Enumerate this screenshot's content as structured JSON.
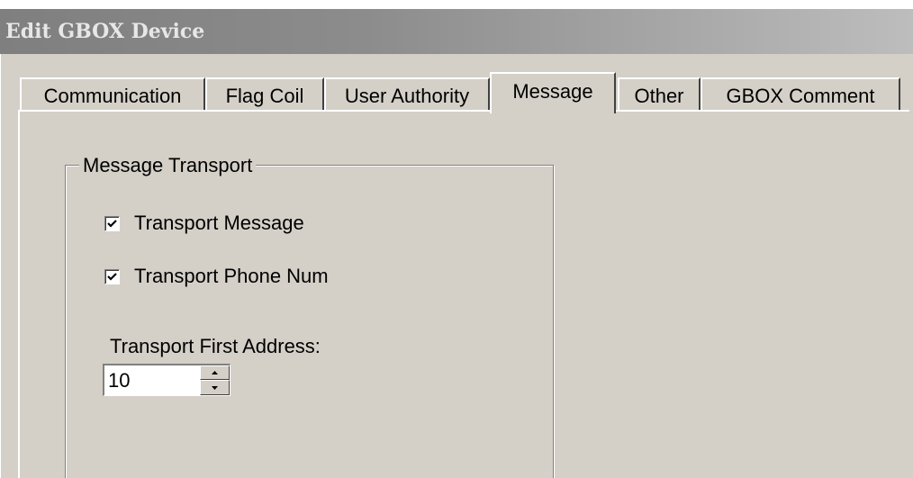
{
  "window": {
    "title": "Edit GBOX Device"
  },
  "tabs": [
    {
      "label": "Communication",
      "active": false
    },
    {
      "label": "Flag Coil",
      "active": false
    },
    {
      "label": "User Authority",
      "active": false
    },
    {
      "label": "Message",
      "active": true
    },
    {
      "label": "Other",
      "active": false
    },
    {
      "label": "GBOX Comment",
      "active": false
    }
  ],
  "message_transport": {
    "group_label": "Message Transport",
    "transport_message": {
      "label": "Transport Message",
      "checked": true
    },
    "transport_phone_num": {
      "label": "Transport Phone Num",
      "checked": true
    },
    "first_address": {
      "label": "Transport First Address:",
      "value": "10"
    }
  },
  "icons": {
    "check": "checkmark-icon",
    "spin_up": "triangle-up-icon",
    "spin_down": "triangle-down-icon"
  }
}
